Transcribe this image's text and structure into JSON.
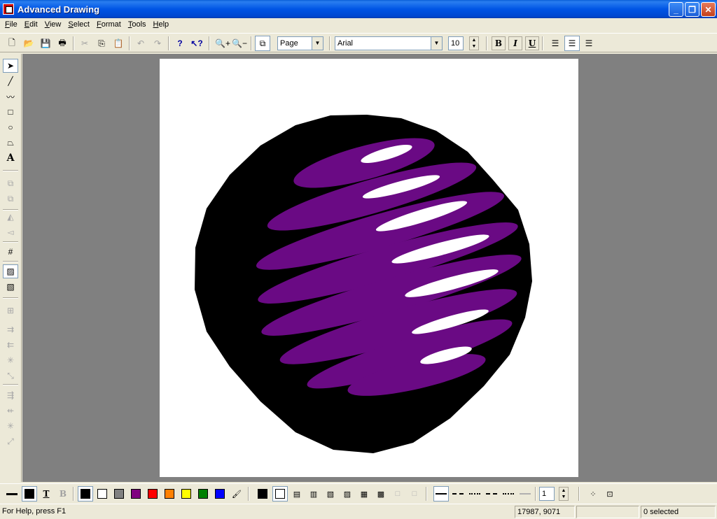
{
  "window": {
    "title": "Advanced Drawing"
  },
  "menu": [
    "File",
    "Edit",
    "View",
    "Select",
    "Format",
    "Tools",
    "Help"
  ],
  "toolbar": {
    "zoom_mode": "Page",
    "font_name": "Arial",
    "font_size": "10",
    "bold_label": "B",
    "italic_label": "I",
    "underline_label": "U"
  },
  "left_tools": {
    "text_tool_label": "A"
  },
  "palette": {
    "text_color_label": "T",
    "back_color_label": "B",
    "line_width": "1",
    "colors": [
      "#000000",
      "#ffffff",
      "#808080",
      "#800080",
      "#ff0000",
      "#ff8000",
      "#ffff00",
      "#008000",
      "#0000ff"
    ],
    "current_line_color": "#000000",
    "current_fill_color": "#000000"
  },
  "drawing": {
    "sphere_color": "#000000",
    "band_color": "#6a0a84",
    "highlight_color": "#ffffff"
  },
  "status": {
    "help_text": "For Help, press F1",
    "coordinates": "17987, 9071",
    "selection": "0 selected"
  }
}
